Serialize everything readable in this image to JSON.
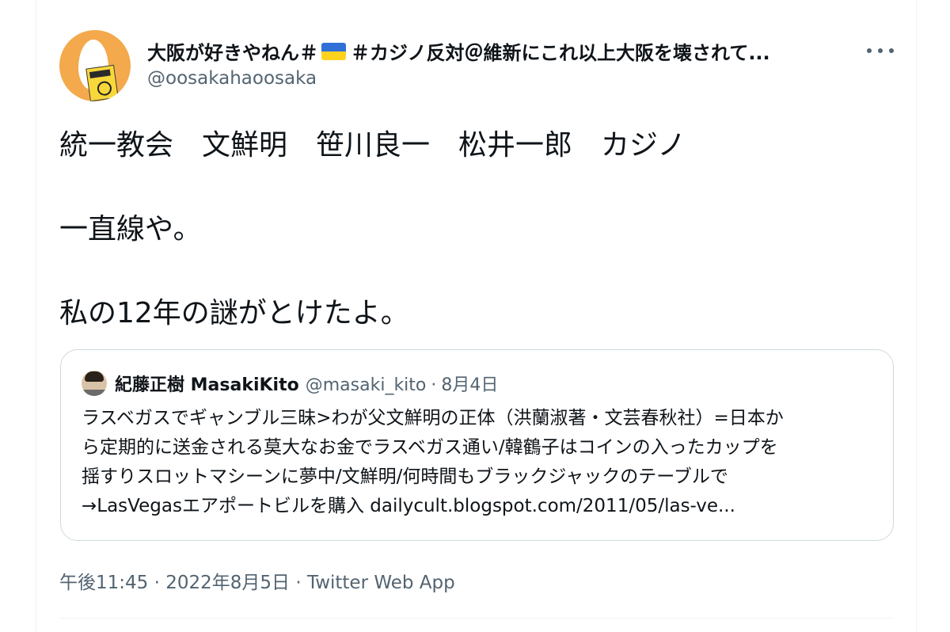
{
  "author": {
    "name_part1": "大阪が好きやねん＃",
    "name_part2": "＃カジノ反対＠維新にこれ以上大阪を壊されて...",
    "flag_colors": [
      "#2f6fd6",
      "#ffd21f"
    ],
    "handle": "@oosakahaoosaka",
    "avatar_icon": "egg-avatar-with-sign"
  },
  "more_icon": "more-options-icon",
  "tweet": {
    "lines": [
      "統一教会　文鮮明　笹川良一　松井一郎　カジノ",
      "一直線や。",
      "私の12年の謎がとけたよ。"
    ]
  },
  "quote": {
    "name": "紀藤正樹 MasakiKito",
    "handle": "@masaki_kito",
    "separator": "·",
    "date": "8月4日",
    "lines": [
      "ラスベガスでギャンブル三昧>わが父文鮮明の正体（洪蘭淑著・文芸春秋社）=日本か",
      "ら定期的に送金される莫大なお金でラスベガス通い/韓鶴子はコインの入ったカップを",
      "揺すりスロットマシーンに夢中/文鮮明/何時間もブラックジャックのテーブルで",
      "→LasVegasエアポートビルを購入 dailycult.blogspot.com/2011/05/las-ve..."
    ]
  },
  "meta": {
    "text": "午後11:45 · 2022年8月5日 · Twitter Web App"
  },
  "colors": {
    "text_primary": "#0f1419",
    "text_secondary": "#536471",
    "border": "#cfd9de"
  }
}
